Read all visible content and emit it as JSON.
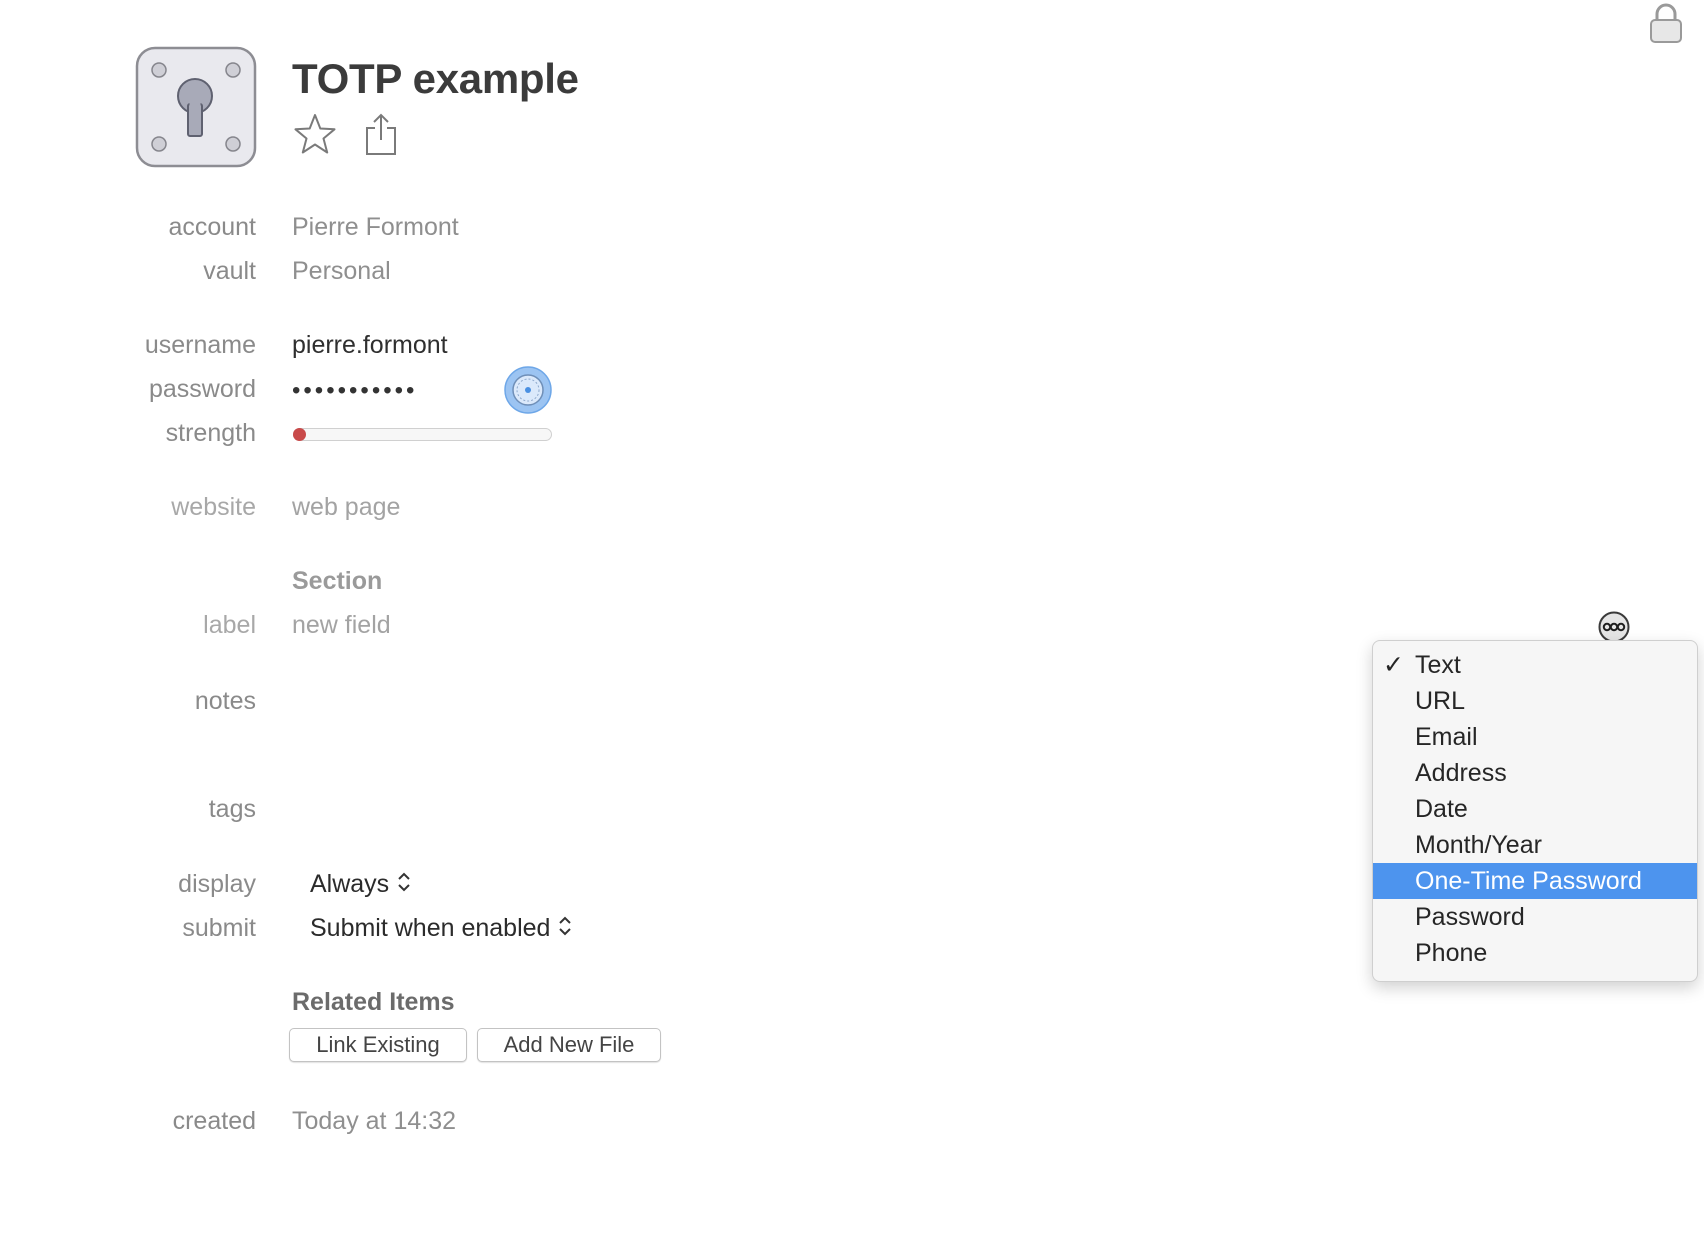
{
  "header": {
    "title": "TOTP example",
    "icons": [
      "vault-item-icon",
      "star-icon",
      "share-icon",
      "lock-icon"
    ]
  },
  "fields": {
    "account": {
      "label": "account",
      "value": "Pierre Formont"
    },
    "vault": {
      "label": "vault",
      "value": "Personal"
    },
    "username": {
      "label": "username",
      "value": "pierre.formont"
    },
    "password": {
      "label": "password",
      "value": "•••••••••••"
    },
    "strength": {
      "label": "strength",
      "level": 0.05,
      "color": "#c94a4a"
    },
    "website": {
      "label": "website",
      "placeholder": "web page"
    }
  },
  "section": {
    "title": "Section",
    "field_label": "label",
    "field_placeholder": "new field"
  },
  "notes": {
    "label": "notes"
  },
  "tags": {
    "label": "tags"
  },
  "display": {
    "label": "display",
    "value": "Always"
  },
  "submit": {
    "label": "submit",
    "value": "Submit when enabled"
  },
  "related": {
    "title": "Related Items",
    "link_existing": "Link Existing",
    "add_new_file": "Add New File"
  },
  "created": {
    "label": "created",
    "value": "Today at 14:32"
  },
  "type_menu": {
    "check_mark": "✓",
    "checked_item": "Text",
    "highlighted_item": "One-Time Password",
    "highlight_color": "#4d94ee",
    "items": [
      "Text",
      "URL",
      "Email",
      "Address",
      "Date",
      "Month/Year",
      "One-Time Password",
      "Password",
      "Phone"
    ]
  }
}
